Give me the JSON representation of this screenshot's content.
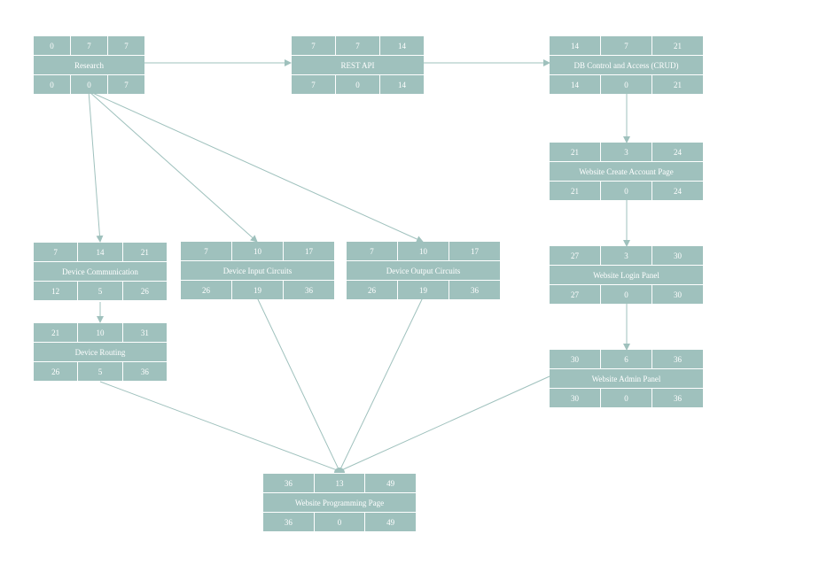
{
  "nodes": [
    {
      "id": "research",
      "name": "Research",
      "es": "0",
      "dur": "7",
      "ef": "7",
      "ls": "0",
      "slack": "0",
      "lf": "7"
    },
    {
      "id": "rest-api",
      "name": "REST API",
      "es": "7",
      "dur": "7",
      "ef": "14",
      "ls": "7",
      "slack": "0",
      "lf": "14"
    },
    {
      "id": "db-control",
      "name": "DB Control and Access (CRUD)",
      "es": "14",
      "dur": "7",
      "ef": "21",
      "ls": "14",
      "slack": "0",
      "lf": "21"
    },
    {
      "id": "create-account",
      "name": "Website Create Account Page",
      "es": "21",
      "dur": "3",
      "ef": "24",
      "ls": "21",
      "slack": "0",
      "lf": "24"
    },
    {
      "id": "login-panel",
      "name": "Website Login Panel",
      "es": "27",
      "dur": "3",
      "ef": "30",
      "ls": "27",
      "slack": "0",
      "lf": "30"
    },
    {
      "id": "admin-panel",
      "name": "Website Admin Panel",
      "es": "30",
      "dur": "6",
      "ef": "36",
      "ls": "30",
      "slack": "0",
      "lf": "36"
    },
    {
      "id": "device-communication",
      "name": "Device Communication",
      "es": "7",
      "dur": "14",
      "ef": "21",
      "ls": "12",
      "slack": "5",
      "lf": "26"
    },
    {
      "id": "device-routing",
      "name": "Device Routing",
      "es": "21",
      "dur": "10",
      "ef": "31",
      "ls": "26",
      "slack": "5",
      "lf": "36"
    },
    {
      "id": "device-input",
      "name": "Device Input Circuits",
      "es": "7",
      "dur": "10",
      "ef": "17",
      "ls": "26",
      "slack": "19",
      "lf": "36"
    },
    {
      "id": "device-output",
      "name": "Device Output Circuits",
      "es": "7",
      "dur": "10",
      "ef": "17",
      "ls": "26",
      "slack": "19",
      "lf": "36"
    },
    {
      "id": "programming-page",
      "name": "Website Programming Page",
      "es": "36",
      "dur": "13",
      "ef": "49",
      "ls": "36",
      "slack": "0",
      "lf": "49"
    }
  ],
  "colors": {
    "node": "#9fc1bd",
    "edge": "#9fc1bd",
    "text": "#ffffff"
  }
}
